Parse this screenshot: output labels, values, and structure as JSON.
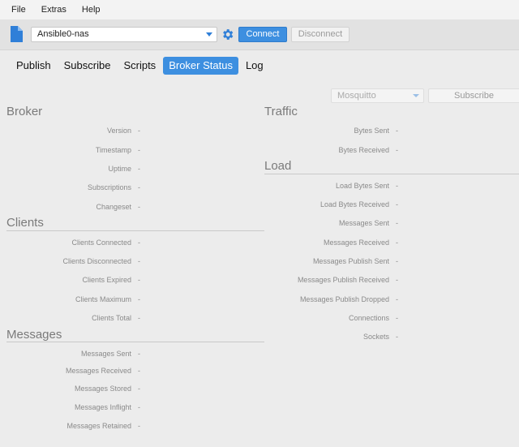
{
  "menu": {
    "file": "File",
    "extras": "Extras",
    "help": "Help"
  },
  "toolbar": {
    "connection_value": "Ansible0-nas",
    "connect_label": "Connect",
    "disconnect_label": "Disconnect"
  },
  "tabs": [
    {
      "label": "Publish"
    },
    {
      "label": "Subscribe"
    },
    {
      "label": "Scripts"
    },
    {
      "label": "Broker Status",
      "active": true
    },
    {
      "label": "Log"
    }
  ],
  "subscription": {
    "broker_type": "Mosquitto",
    "subscribe_label": "Subscribe"
  },
  "broker": {
    "title": "Broker",
    "rows": [
      {
        "label": "Version",
        "value": "-"
      },
      {
        "label": "Timestamp",
        "value": "-"
      },
      {
        "label": "Uptime",
        "value": "-"
      },
      {
        "label": "Subscriptions",
        "value": "-"
      },
      {
        "label": "Changeset",
        "value": "-"
      }
    ]
  },
  "clients": {
    "title": "Clients",
    "rows": [
      {
        "label": "Clients Connected",
        "value": "-"
      },
      {
        "label": "Clients Disconnected",
        "value": "-"
      },
      {
        "label": "Clients Expired",
        "value": "-"
      },
      {
        "label": "Clients Maximum",
        "value": "-"
      },
      {
        "label": "Clients Total",
        "value": "-"
      }
    ]
  },
  "messages": {
    "title": "Messages",
    "rows": [
      {
        "label": "Messages Sent",
        "value": "-"
      },
      {
        "label": "Messages Received",
        "value": "-"
      },
      {
        "label": "Messages Stored",
        "value": "-"
      },
      {
        "label": "Messages Inflight",
        "value": "-"
      },
      {
        "label": "Messages Retained",
        "value": "-"
      }
    ]
  },
  "traffic": {
    "title": "Traffic",
    "rows": [
      {
        "label": "Bytes Sent",
        "value": "-"
      },
      {
        "label": "Bytes Received",
        "value": "-"
      }
    ]
  },
  "load": {
    "title": "Load",
    "rows": [
      {
        "label": "Load Bytes Sent",
        "value": "-"
      },
      {
        "label": "Load Bytes Received",
        "value": "-"
      },
      {
        "label": "Messages Sent",
        "value": "-"
      },
      {
        "label": "Messages Received",
        "value": "-"
      },
      {
        "label": "Messages Publish Sent",
        "value": "-"
      },
      {
        "label": "Messages Publish Received",
        "value": "-"
      },
      {
        "label": "Messages Publish Dropped",
        "value": "-"
      },
      {
        "label": "Connections",
        "value": "-"
      },
      {
        "label": "Sockets",
        "value": "-"
      }
    ]
  },
  "colors": {
    "accent": "#3d8fe0",
    "background": "#ececec"
  }
}
